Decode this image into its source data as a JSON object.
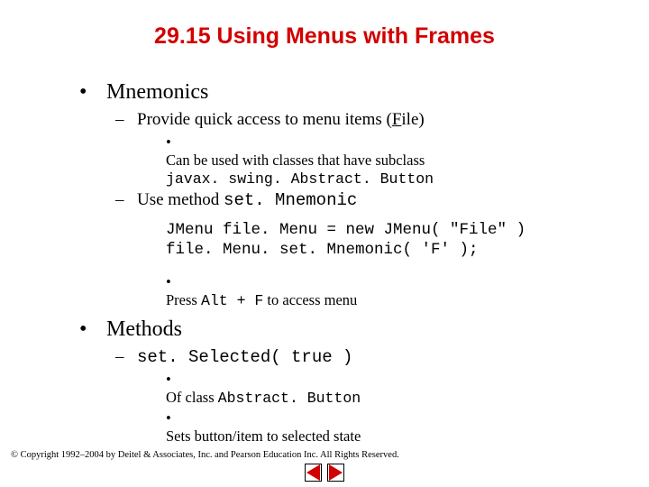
{
  "title": "29.15  Using Menus with Frames",
  "b1": {
    "bullet": "•",
    "text": "Mnemonics"
  },
  "b1a": {
    "bullet": "–",
    "pre": "Provide quick access to menu items (",
    "ul": "F",
    "post": "ile)"
  },
  "b1a1": {
    "bullet": "•",
    "line1": "Can be used with classes that have subclass",
    "line2": "javax. swing. Abstract. Button"
  },
  "b1b": {
    "bullet": "–",
    "text1": "Use method ",
    "code": "set. Mnemonic"
  },
  "code": "JMenu file. Menu = new JMenu( \"File\" )\nfile. Menu. set. Mnemonic( 'F' );",
  "b1b1": {
    "bullet": "•",
    "text1": "Press ",
    "code": "Alt + F",
    "text2": " to access menu"
  },
  "b2": {
    "bullet": "•",
    "text": "Methods"
  },
  "b2a": {
    "bullet": "–",
    "code": "set. Selected( true )"
  },
  "b2a1": {
    "bullet": "•",
    "text1": "Of class ",
    "code": "Abstract. Button"
  },
  "b2a2": {
    "bullet": "•",
    "text": "Sets button/item to selected state"
  },
  "copyright": "© Copyright 1992–2004 by Deitel & Associates, Inc. and Pearson Education Inc. All Rights Reserved."
}
